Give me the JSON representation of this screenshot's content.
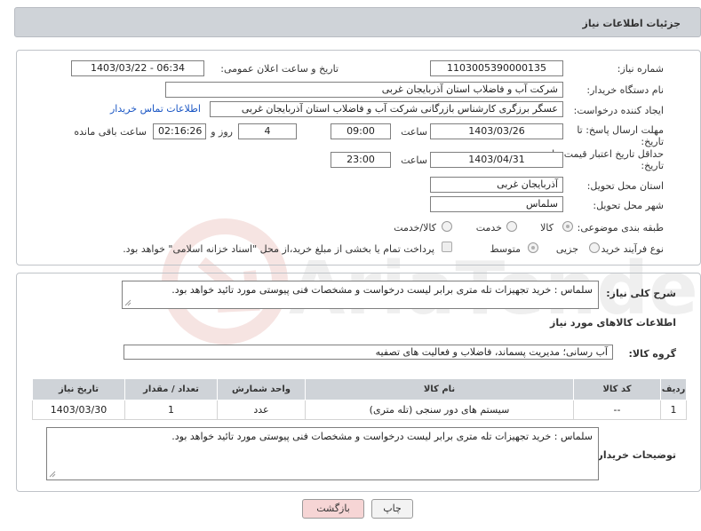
{
  "header": {
    "title": "جزئیات اطلاعات نیاز"
  },
  "fields": {
    "need_number_label": "شماره نیاز:",
    "need_number": "1103005390000135",
    "announce_label": "تاریخ و ساعت اعلان عمومی:",
    "announce_value": "1403/03/22 - 06:34",
    "buyer_org_label": "نام دستگاه خریدار:",
    "buyer_org": "شرکت آب و فاضلاب استان آذربایجان غربی",
    "requester_label": "ایجاد کننده درخواست:",
    "requester": "عسگر  برزگری کارشناس بازرگانی شرکت آب و فاضلاب استان آذربایجان غربی",
    "contact_link": "اطلاعات تماس خریدار",
    "deadline_label_1": "مهلت ارسال پاسخ: تا",
    "deadline_label_2": "تاریخ:",
    "deadline_date": "1403/03/26",
    "time_label": "ساعت",
    "deadline_time": "09:00",
    "days_value": "4",
    "days_label": "روز و",
    "remaining_time": "02:16:26",
    "remaining_label": "ساعت باقی مانده",
    "price_valid_label_1": "حداقل تاریخ اعتبار قیمت: تا",
    "price_valid_label_2": "تاریخ:",
    "price_valid_date": "1403/04/31",
    "price_valid_time_label": "ساعت",
    "price_valid_time": "23:00",
    "province_label": "استان محل تحویل:",
    "province": "آذربایجان غربی",
    "city_label": "شهر محل تحویل:",
    "city": "سلماس",
    "category_label": "طبقه بندی موضوعی:",
    "category_options": [
      "کالا",
      "خدمت",
      "کالا/خدمت"
    ],
    "process_label": "نوع فرآیند خرید :",
    "process_options": [
      "جزیی",
      "متوسط"
    ],
    "payment_note": "پرداخت تمام یا بخشی از مبلغ خرید،از محل \"اسناد خزانه اسلامی\" خواهد بود."
  },
  "description": {
    "label": "شرح کلی نیاز:",
    "text": "سلماس : خرید تجهیزات تله متری برابر لیست درخواست و مشخصات فنی پیوستی مورد تائید خواهد بود."
  },
  "goods_section": {
    "title": "اطلاعات کالاهای مورد نیاز",
    "group_label": "گروه کالا:",
    "group_value": "آب رسانی؛ مدیریت پسماند، فاضلاب و فعالیت های تصفیه"
  },
  "table": {
    "headers": [
      "ردیف",
      "کد کالا",
      "نام کالا",
      "واحد شمارش",
      "تعداد / مقدار",
      "تاریخ نیاز"
    ],
    "rows": [
      [
        "1",
        "--",
        "سیستم های دور سنجی (تله متری)",
        "عدد",
        "1",
        "1403/03/30"
      ]
    ]
  },
  "buyer_notes": {
    "label": "توضیحات خریدار:",
    "text": "سلماس : خرید تجهیزات تله متری برابر لیست درخواست و مشخصات فنی پیوستی مورد تائید خواهد بود."
  },
  "buttons": {
    "print": "چاپ",
    "back": "بازگشت"
  },
  "watermark": {
    "text": "AriaTender.neT",
    "color": "#c0392b"
  }
}
